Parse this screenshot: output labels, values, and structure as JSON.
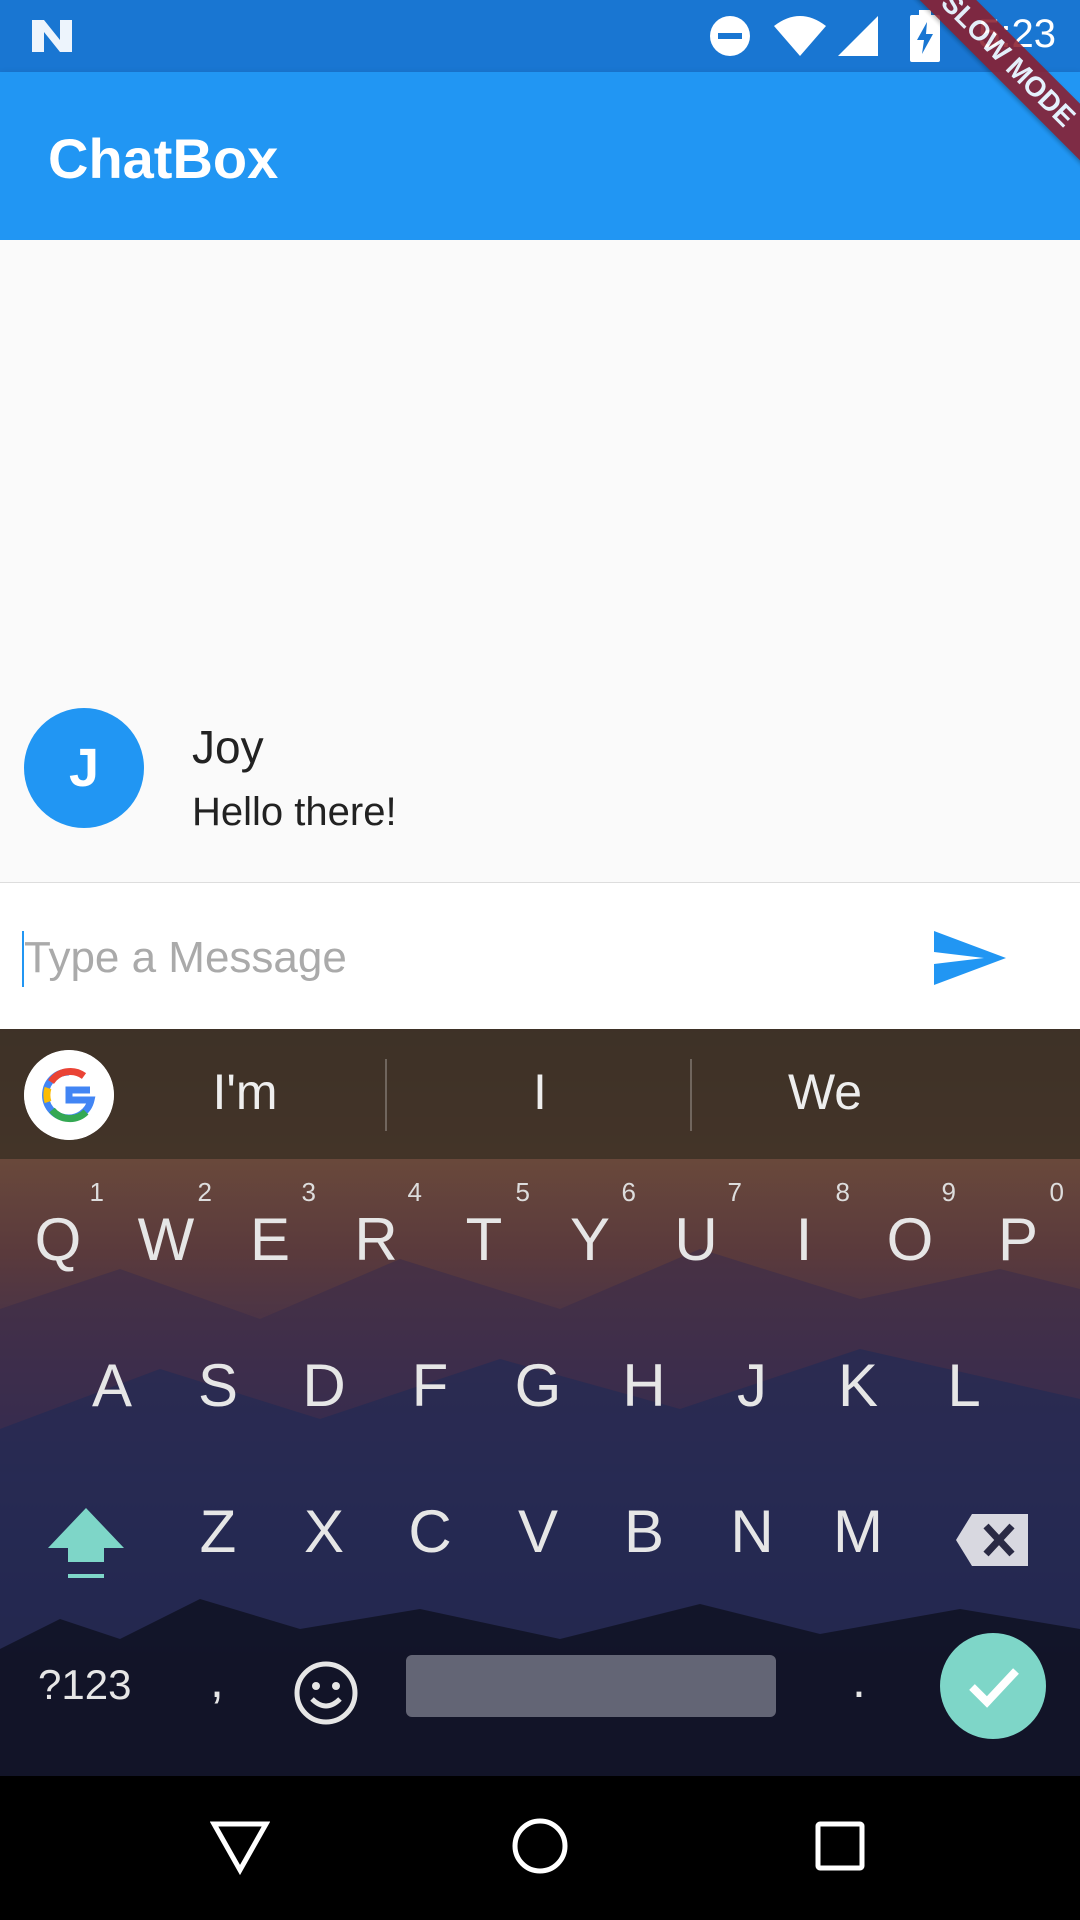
{
  "status_bar": {
    "time": "5:23",
    "icons": [
      "android-n-icon",
      "do-not-disturb-icon",
      "wifi-icon",
      "cell-signal-icon",
      "battery-charging-icon"
    ]
  },
  "debug_banner": {
    "label": "SLOW MODE"
  },
  "app_bar": {
    "title": "ChatBox"
  },
  "messages": [
    {
      "avatar_initial": "J",
      "sender": "Joy",
      "text": "Hello there!"
    }
  ],
  "composer": {
    "placeholder": "Type a Message",
    "value": "",
    "send_icon": "send-icon"
  },
  "keyboard": {
    "suggestions": [
      "I'm",
      "I",
      "We"
    ],
    "row1": [
      {
        "key": "Q",
        "hint": "1"
      },
      {
        "key": "W",
        "hint": "2"
      },
      {
        "key": "E",
        "hint": "3"
      },
      {
        "key": "R",
        "hint": "4"
      },
      {
        "key": "T",
        "hint": "5"
      },
      {
        "key": "Y",
        "hint": "6"
      },
      {
        "key": "U",
        "hint": "7"
      },
      {
        "key": "I",
        "hint": "8"
      },
      {
        "key": "O",
        "hint": "9"
      },
      {
        "key": "P",
        "hint": "0"
      }
    ],
    "row2": [
      "A",
      "S",
      "D",
      "F",
      "G",
      "H",
      "J",
      "K",
      "L"
    ],
    "row3": [
      "Z",
      "X",
      "C",
      "V",
      "B",
      "N",
      "M"
    ],
    "symbols_label": "?123",
    "comma": ",",
    "period": ".",
    "accent_color": "#7ed6c8"
  },
  "colors": {
    "primary": "#2196f3",
    "status_bar": "#1976d2",
    "banner": "#8b1e2e"
  },
  "nav_bar": {
    "icons": [
      "back-icon",
      "home-icon",
      "recents-icon"
    ]
  }
}
